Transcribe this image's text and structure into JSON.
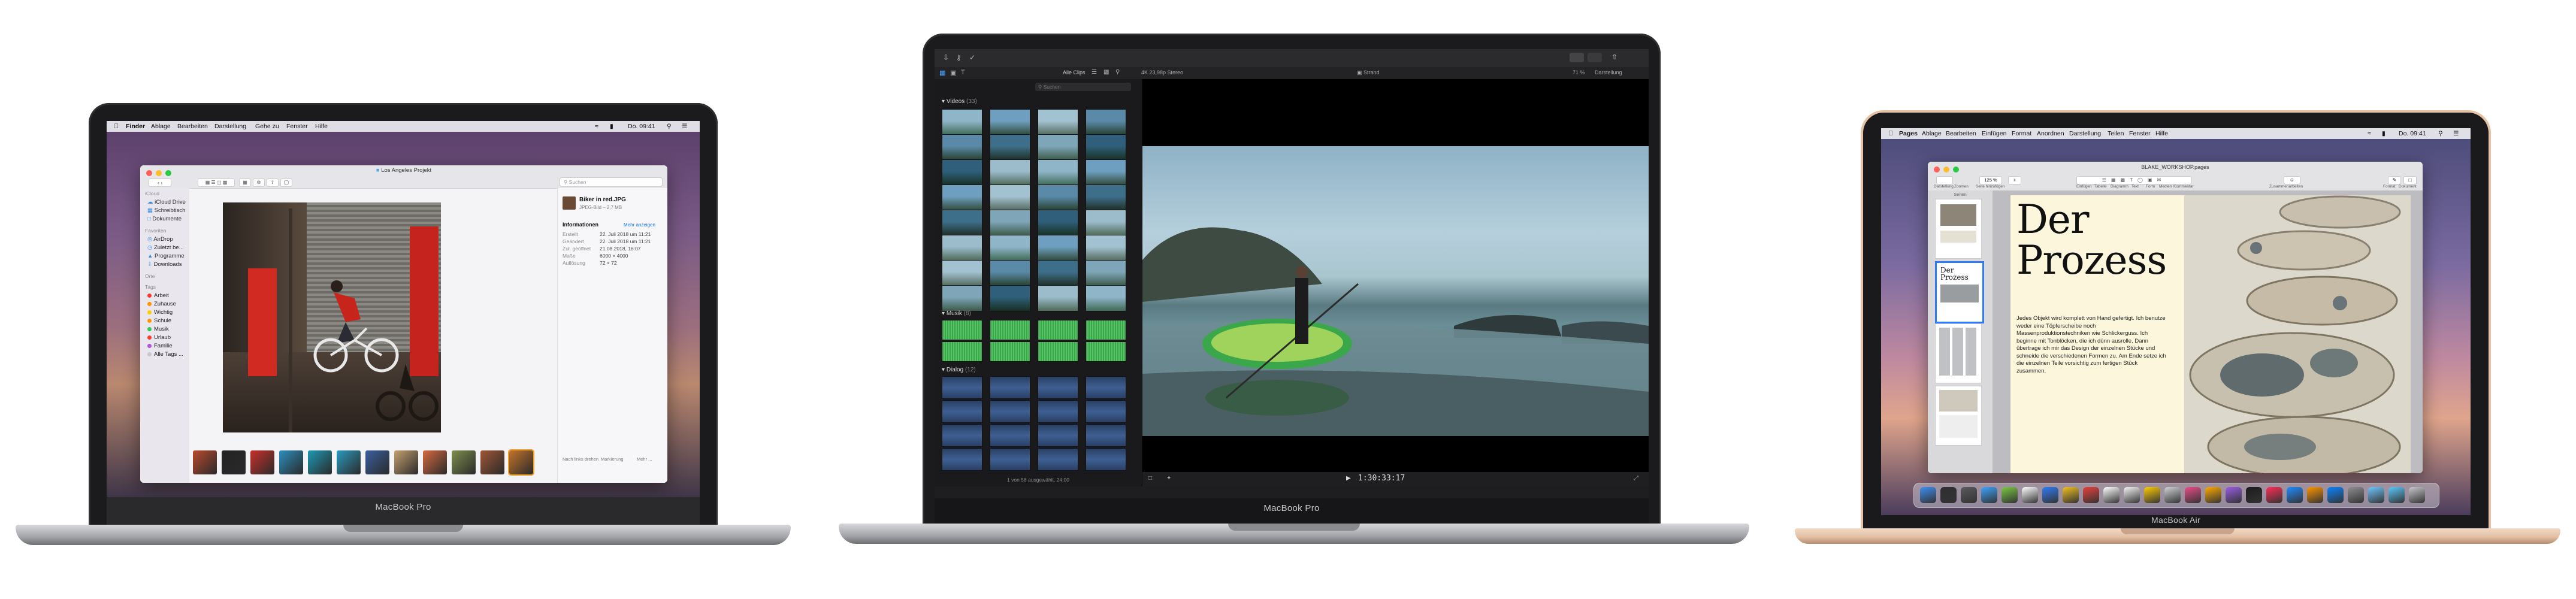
{
  "laptop1": {
    "model_label": "MacBook Pro",
    "menubar": {
      "items": [
        "Finder",
        "Ablage",
        "Bearbeiten",
        "Darstellung",
        "Gehe zu",
        "Fenster",
        "Hilfe"
      ],
      "clock": "Do. 09:41"
    },
    "finder": {
      "window_title": "Los Angeles Projekt",
      "search_placeholder": "Suchen",
      "sidebar": {
        "head_cloud": "iCloud",
        "cloud_items": [
          "iCloud Drive",
          "Schreibtisch",
          "Dokumente"
        ],
        "head_favorites": "Favoriten",
        "favorite_items": [
          "AirDrop",
          "Zuletzt be...",
          "Programme",
          "Downloads"
        ],
        "head_places": "Orte",
        "head_tags": "Tags",
        "tags": [
          {
            "label": "Arbeit",
            "color": "#ff3b30"
          },
          {
            "label": "Zuhause",
            "color": "#ff9500"
          },
          {
            "label": "Wichtig",
            "color": "#ffcc00"
          },
          {
            "label": "Schule",
            "color": "#ff9500"
          },
          {
            "label": "Musik",
            "color": "#34c759"
          },
          {
            "label": "Urlaub",
            "color": "#ff3b30"
          },
          {
            "label": "Familie",
            "color": "#af52de"
          },
          {
            "label": "Alle Tags ...",
            "color": "#c7c7cc"
          }
        ]
      },
      "preview": {
        "file_name": "Biker in red.JPG",
        "file_meta": "JPEG-Bild – 2,7 MB",
        "info_title": "Informationen",
        "info_more": "Mehr anzeigen",
        "info_rows": [
          {
            "key": "Erstellt",
            "value": "22. Juli 2018 um 11:21"
          },
          {
            "key": "Geändert",
            "value": "22. Juli 2018 um 11:21"
          },
          {
            "key": "Zul. geöffnet",
            "value": "21.08.2018, 16:07"
          },
          {
            "key": "Maße",
            "value": "6000 × 4000"
          },
          {
            "key": "Auflösung",
            "value": "72 × 72"
          }
        ],
        "actions": [
          "Nach links drehen",
          "Markierung",
          "Mehr ..."
        ]
      },
      "thumbnails": [
        "#b94a2c",
        "#222222",
        "#c9302a",
        "#2b8fbf",
        "#1d9ab5",
        "#2a9abf",
        "#3a5fa0",
        "#c5a070",
        "#d66a40",
        "#7e8f4e",
        "#a05535",
        "#c4732a"
      ]
    }
  },
  "laptop2": {
    "model_label": "MacBook Pro",
    "fcp": {
      "all_clips_label": "Alle Clips",
      "resolution_label": "4K 23,98p Stereo",
      "project_label": "Strand",
      "zoom_label": "71 %",
      "view_label": "Darstellung",
      "search_placeholder": "Suchen",
      "section_videos": "Videos",
      "section_videos_count": "(33)",
      "section_music": "Musik",
      "section_music_count": "(8)",
      "section_dialog": "Dialog",
      "section_dialog_count": "(12)",
      "selection_status": "1 von 58 ausgewählt, 24:00",
      "timecode": "1:30:33:17"
    }
  },
  "laptop3": {
    "model_label": "MacBook Air",
    "menubar": {
      "items": [
        "Pages",
        "Ablage",
        "Bearbeiten",
        "Einfügen",
        "Format",
        "Anordnen",
        "Darstellung",
        "Teilen",
        "Fenster",
        "Hilfe"
      ],
      "clock": "Do. 09:41"
    },
    "pages": {
      "document_title": "BLAKE_WORKSHOP.pages",
      "zoom_label": "125 %",
      "toolbar_labels": [
        "Darstellung",
        "Zoomen",
        "Seite hinzufügen",
        "Einfügen",
        "Tabelle",
        "Diagramm",
        "Text",
        "Form",
        "Medien",
        "Kommentar",
        "Zusammenarbeiten",
        "Format",
        "Dokument"
      ],
      "sidebar_label": "Seiten",
      "heading_line1": "Der",
      "heading_line2": "Prozess",
      "body_text": "Jedes Objekt wird komplett von Hand gefertigt. Ich benutze weder eine Töpferscheibe noch Massenproduktionstechniken wie Schlickerguss. Ich beginne mit Tonblöcken, die ich dünn ausrolle. Dann übertrage ich mir das Design der einzelnen Stücke und schneide die verschiedenen Formen zu. Am Ende setze ich die einzelnen Teile vorsichtig zum fertigen Stück zusammen."
    },
    "dock_colors": [
      "#3d8ff3",
      "#2f2f35",
      "#5a5a5f",
      "#3ca3ff",
      "#7ac943",
      "#ffffff",
      "#2e7cf6",
      "#f0c020",
      "#e7413a",
      "#ffffff",
      "#f5f5f5",
      "#ffcc00",
      "#cfd2d6",
      "#ea4c89",
      "#ffaa00",
      "#9b5de5",
      "#1c1c1e",
      "#ff2d55",
      "#1f8cff",
      "#ff9500",
      "#0a84ff",
      "#8e8e93",
      "#6ec6ff",
      "#5ac8fa",
      "#c7c7cc"
    ]
  }
}
